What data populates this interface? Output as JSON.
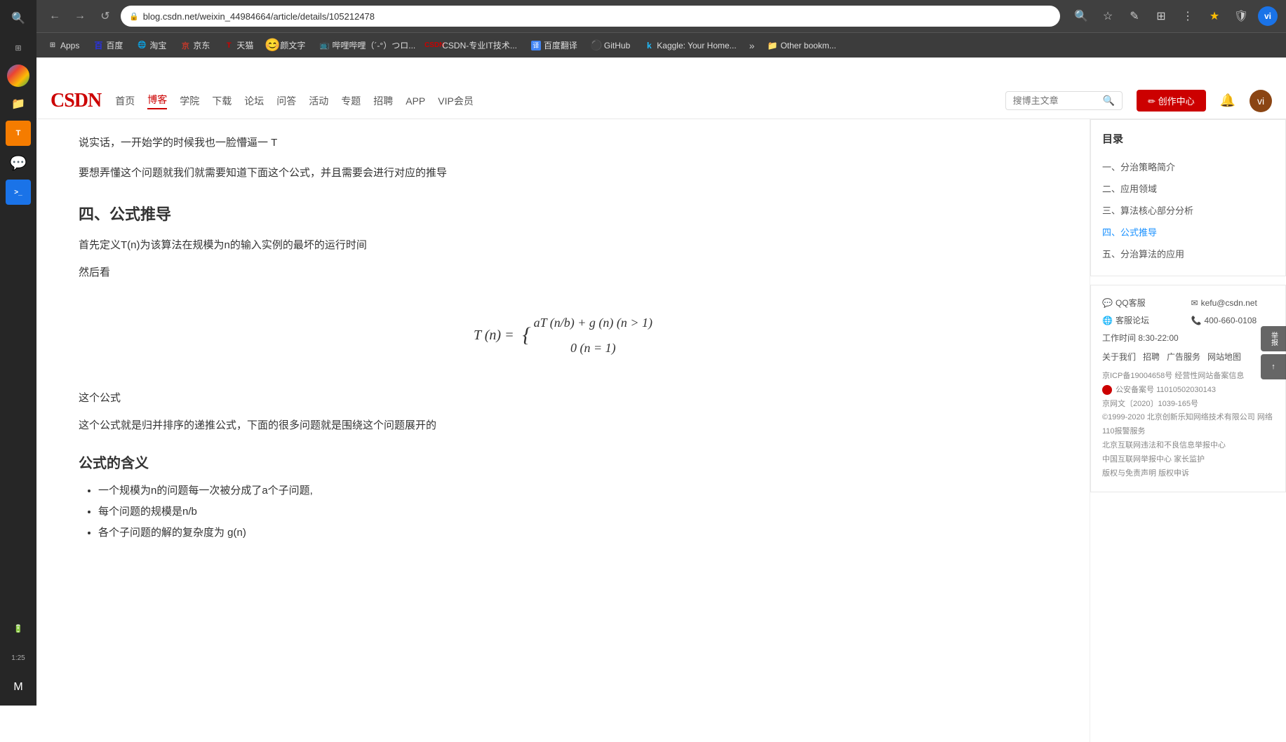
{
  "browser": {
    "back_label": "←",
    "forward_label": "→",
    "reload_label": "↺",
    "url": "blog.csdn.net/weixin_44984664/article/details/105212478",
    "search_icon": "🔍",
    "star_icon": "☆",
    "pen_icon": "✎",
    "ext_icon": "⊞",
    "menu_icon": "⋮",
    "fav_icon": "★",
    "shield_icon": "🛡"
  },
  "bookmarks": {
    "apps_label": "Apps",
    "items": [
      {
        "label": "百度",
        "icon": "🔵"
      },
      {
        "label": "淘宝",
        "icon": "🌐"
      },
      {
        "label": "京东",
        "icon": "🔵"
      },
      {
        "label": "天猫",
        "icon": "🔴"
      },
      {
        "label": "颜文字",
        "icon": "😊"
      },
      {
        "label": "哔哩哔哩（´-°）つロ...",
        "icon": "📺"
      },
      {
        "label": "CSDN-专业IT技术...",
        "icon": "🔷"
      },
      {
        "label": "百度翻译",
        "icon": "译"
      },
      {
        "label": "GitHub",
        "icon": "⚫"
      },
      {
        "label": "Kaggle: Your Home...",
        "icon": "k"
      }
    ],
    "more_label": "»",
    "other_label": "Other bookm..."
  },
  "csdn_header": {
    "logo": "CSDN",
    "nav_items": [
      {
        "label": "首页",
        "active": false
      },
      {
        "label": "博客",
        "active": true
      },
      {
        "label": "学院",
        "active": false
      },
      {
        "label": "下载",
        "active": false
      },
      {
        "label": "论坛",
        "active": false
      },
      {
        "label": "问答",
        "active": false
      },
      {
        "label": "活动",
        "active": false
      },
      {
        "label": "专题",
        "active": false
      },
      {
        "label": "招聘",
        "active": false
      },
      {
        "label": "APP",
        "active": false
      },
      {
        "label": "VIP会员",
        "active": false
      }
    ],
    "search_placeholder": "搜博主文章",
    "create_btn": "✏ 创作中心",
    "avatar_text": "vi"
  },
  "article": {
    "intro_text": "说实话，一开始学的时候我也一脸懵逼一 T",
    "intro_text2": "要想弄懂这个问题就我们就需要知道下面这个公式，并且需要会进行对应的推导",
    "section4_title": "四、公式推导",
    "define_text": "首先定义T(n)为该算法在规模为n的输入实例的最坏的运行时间",
    "then_text": "然后看",
    "formula_display": "T(n) = { aT(n/b) + g(n) (n > 1) / 0 (n = 1)",
    "formula_line1": "T (n) =",
    "formula_brace1": "aT (n/b) + g (n)  (n > 1)",
    "formula_brace2": "0  (n = 1)",
    "this_formula_text": "这个公式",
    "this_formula_desc": "这个公式就是归并排序的递推公式，下面的很多问题就是围绕这个问题展开的",
    "subsection_title": "公式的含义",
    "bullet1": "一个规模为n的问题每一次被分成了a个子问题,",
    "bullet2": "每个问题的规模是n/b",
    "bullet3": "各个子问题的解的复杂度为 g(n)"
  },
  "toc": {
    "title": "目录",
    "items": [
      {
        "label": "一、分治策略简介",
        "active": false
      },
      {
        "label": "二、应用领域",
        "active": false
      },
      {
        "label": "三、算法核心部分分析",
        "active": false
      },
      {
        "label": "四、公式推导",
        "active": true
      },
      {
        "label": "五、分治算法的应用",
        "active": false
      }
    ]
  },
  "contact": {
    "qq_label": "QQ客服",
    "email_label": "kefu@csdn.net",
    "forum_label": "客服论坛",
    "phone_label": "400-660-0108",
    "work_hours": "工作时间 8:30-22:00",
    "about": "关于我们",
    "jobs": "招聘",
    "ad": "广告服务",
    "sitemap": "网站地图",
    "icp1": "京ICP备19004658号",
    "icp2": "经营性网站备案信息",
    "police": "公安备案号 11010502030143",
    "jingwen": "京网文〔2020〕1039-165号",
    "copyright": "©1999-2020 北京创新乐知网络技术有限公司",
    "net110": "网络110报警服务",
    "internet_law": "北京互联网违法和不良信息举报中心",
    "internet_report": "中国互联网举报中心",
    "family": "家长监护",
    "rights": "版权与免责声明",
    "copyright2": "版权申诉"
  },
  "float_buttons": [
    {
      "label": "举报"
    },
    {
      "label": "↑"
    }
  ],
  "os_sidebar": {
    "time": "1:25"
  }
}
